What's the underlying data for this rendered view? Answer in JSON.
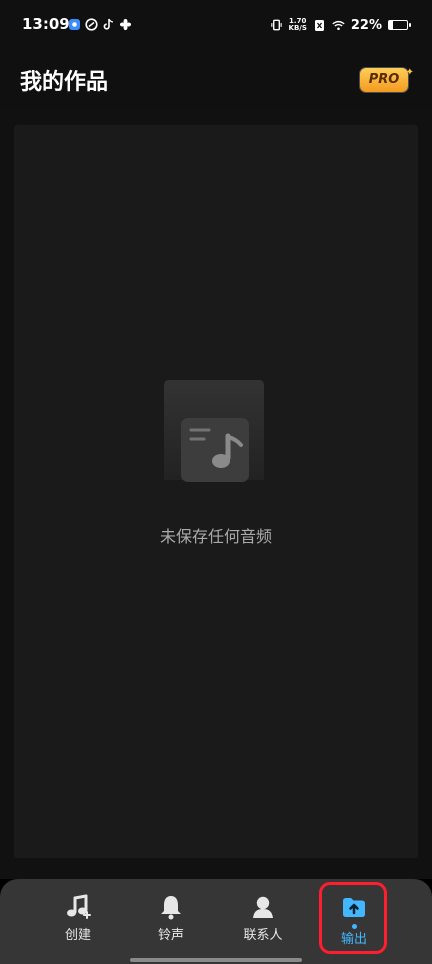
{
  "status": {
    "time": "13:09",
    "network_speed_value": "1.70",
    "network_speed_unit": "KB/S",
    "battery_percent": "22%",
    "battery_level": 0.22,
    "icons": [
      "map-app-icon",
      "messenger-app-icon",
      "tiktok-icon",
      "fan-app-icon",
      "vibrate-icon",
      "sim-x-icon",
      "wifi-icon",
      "battery-icon"
    ]
  },
  "header": {
    "title": "我的作品",
    "pro_label": "PRO"
  },
  "empty_state": {
    "message": "未保存任何音频",
    "icon": "music-file-icon"
  },
  "bottom_nav": {
    "items": [
      {
        "label": "创建",
        "icon": "music-create-icon"
      },
      {
        "label": "铃声",
        "icon": "bell-icon"
      },
      {
        "label": "联系人",
        "icon": "contact-icon"
      },
      {
        "label": "输出",
        "icon": "folder-upload-icon"
      }
    ],
    "active_index": 3
  },
  "colors": {
    "background": "#111111",
    "panel": "#1a1a1a",
    "accent": "#42b7ff",
    "pro_gold": "#ffbf3d",
    "highlight": "#ff1e2e"
  }
}
